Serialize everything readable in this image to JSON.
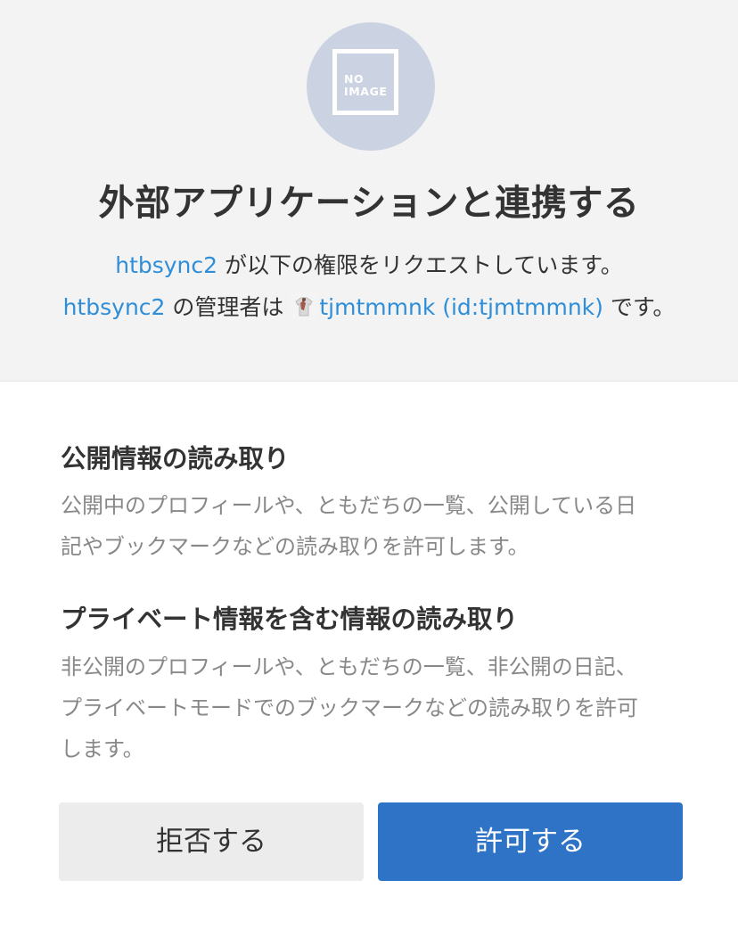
{
  "header": {
    "avatar_text": [
      "NO",
      "IMAGE"
    ],
    "title": "外部アプリケーションと連携する",
    "app_name": "htbsync2",
    "request_text": " が以下の権限をリクエストしています。",
    "app_name_2": "htbsync2",
    "admin_prefix": " の管理者は ",
    "admin_user": "tjmtmmnk (id:tjmtmmnk)",
    "admin_suffix": " です。"
  },
  "permissions": [
    {
      "title": "公開情報の読み取り",
      "description_lines": [
        "公開中のプロフィールや、ともだちの一覧、公開している日",
        "記やブックマークなどの読み取りを許可します。"
      ]
    },
    {
      "title": "プライベート情報を含む情報の読み取り",
      "description_lines": [
        "非公開のプロフィールや、ともだちの一覧、非公開の日記、",
        "プライベートモードでのブックマークなどの読み取りを許可",
        "します。"
      ]
    }
  ],
  "buttons": {
    "deny_label": "拒否する",
    "allow_label": "許可する"
  },
  "colors": {
    "link": "#2f8ed8",
    "allow_button": "#2f73c6",
    "deny_button": "#ececec",
    "avatar_bg": "#cbd3e3"
  },
  "icons": {
    "user_icon": "user-avatar-icon",
    "placeholder": "no-image-icon"
  }
}
